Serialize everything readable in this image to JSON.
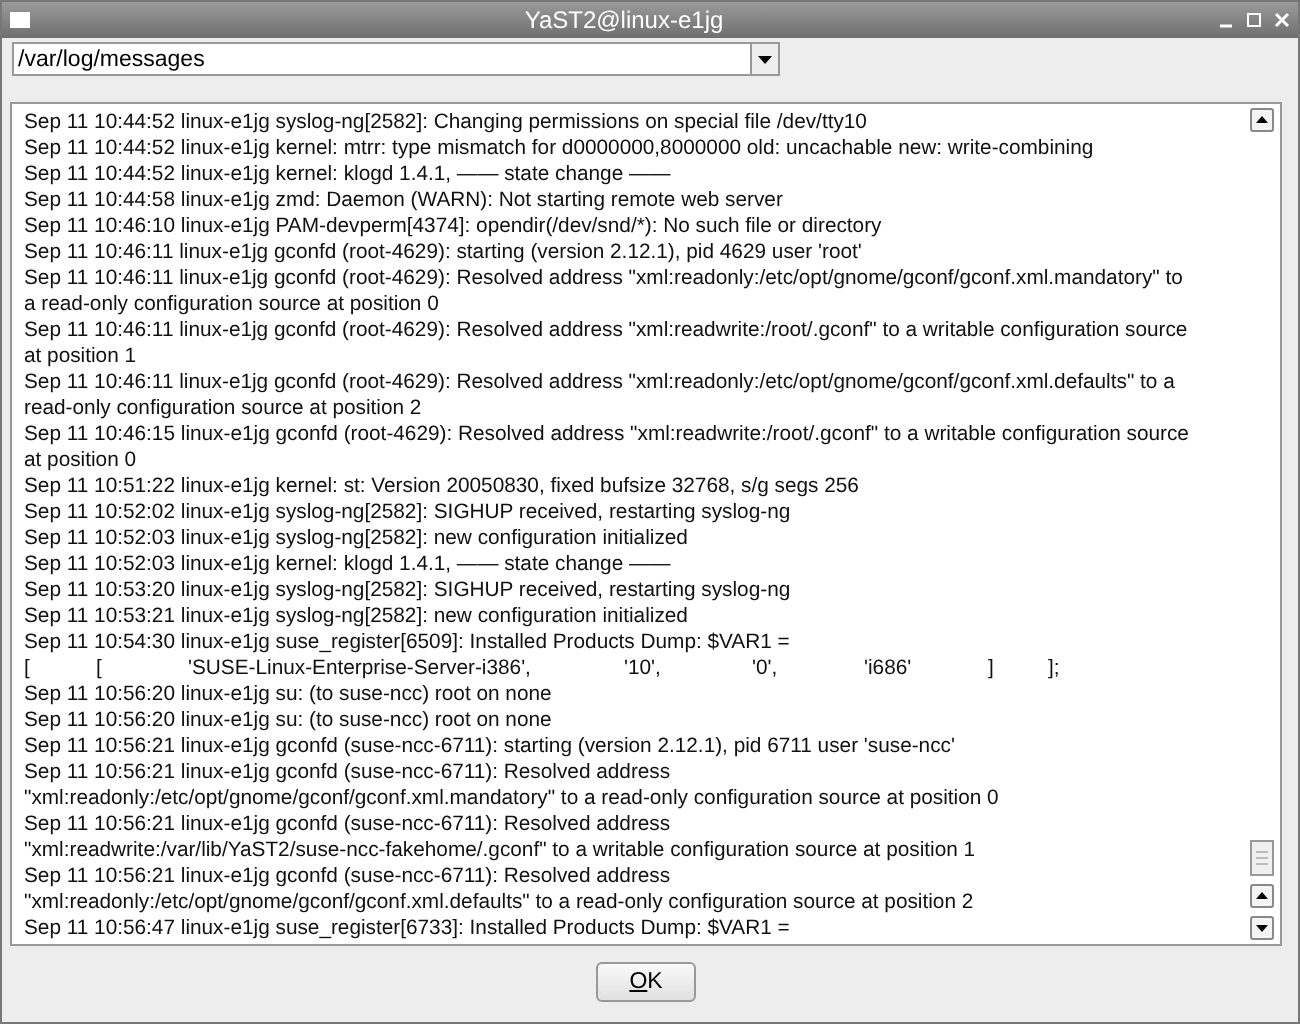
{
  "window": {
    "title": "YaST2@linux-e1jg"
  },
  "file_combo": {
    "value": "/var/log/messages"
  },
  "log_lines": [
    {
      "kind": "text",
      "text": "Sep 11 10:44:52 linux-e1jg syslog-ng[2582]: Changing permissions on special file /dev/tty10"
    },
    {
      "kind": "text",
      "text": "Sep 11 10:44:52 linux-e1jg kernel: mtrr: type mismatch for d0000000,8000000 old: uncachable new: write-combining"
    },
    {
      "kind": "text",
      "text": "Sep 11 10:44:52 linux-e1jg kernel: klogd 1.4.1, —— state change ——"
    },
    {
      "kind": "text",
      "text": "Sep 11 10:44:58 linux-e1jg zmd: Daemon (WARN): Not starting remote web server"
    },
    {
      "kind": "text",
      "text": "Sep 11 10:46:10 linux-e1jg PAM-devperm[4374]: opendir(/dev/snd/*): No such file or directory"
    },
    {
      "kind": "text",
      "text": "Sep 11 10:46:11 linux-e1jg gconfd (root-4629): starting (version 2.12.1), pid 4629 user 'root'"
    },
    {
      "kind": "text",
      "text": "Sep 11 10:46:11 linux-e1jg gconfd (root-4629): Resolved address \"xml:readonly:/etc/opt/gnome/gconf/gconf.xml.mandatory\" to"
    },
    {
      "kind": "text",
      "text": "a read-only configuration source at position 0"
    },
    {
      "kind": "text",
      "text": "Sep 11 10:46:11 linux-e1jg gconfd (root-4629): Resolved address \"xml:readwrite:/root/.gconf\" to a writable configuration source"
    },
    {
      "kind": "text",
      "text": "at position 1"
    },
    {
      "kind": "text",
      "text": "Sep 11 10:46:11 linux-e1jg gconfd (root-4629): Resolved address \"xml:readonly:/etc/opt/gnome/gconf/gconf.xml.defaults\" to a"
    },
    {
      "kind": "text",
      "text": "read-only configuration source at position 2"
    },
    {
      "kind": "text",
      "text": "Sep 11 10:46:15 linux-e1jg gconfd (root-4629): Resolved address \"xml:readwrite:/root/.gconf\" to a writable configuration source"
    },
    {
      "kind": "text",
      "text": "at position 0"
    },
    {
      "kind": "text",
      "text": "Sep 11 10:51:22 linux-e1jg kernel: st: Version 20050830, fixed bufsize 32768, s/g segs 256"
    },
    {
      "kind": "text",
      "text": "Sep 11 10:52:02 linux-e1jg syslog-ng[2582]: SIGHUP received, restarting syslog-ng"
    },
    {
      "kind": "text",
      "text": "Sep 11 10:52:03 linux-e1jg syslog-ng[2582]: new configuration initialized"
    },
    {
      "kind": "text",
      "text": "Sep 11 10:52:03 linux-e1jg kernel: klogd 1.4.1, —— state change ——"
    },
    {
      "kind": "text",
      "text": "Sep 11 10:53:20 linux-e1jg syslog-ng[2582]: SIGHUP received, restarting syslog-ng"
    },
    {
      "kind": "text",
      "text": "Sep 11 10:53:21 linux-e1jg syslog-ng[2582]: new configuration initialized"
    },
    {
      "kind": "text",
      "text": "Sep 11 10:54:30 linux-e1jg suse_register[6509]: Installed Products Dump: $VAR1 ="
    },
    {
      "kind": "columns",
      "cells": [
        "[",
        "[",
        "'SUSE-Linux-Enterprise-Server-i386',",
        "'10',",
        "'0',",
        "'i686'",
        "]",
        "];"
      ]
    },
    {
      "kind": "text",
      "text": "Sep 11 10:56:20 linux-e1jg su: (to suse-ncc) root on none"
    },
    {
      "kind": "text",
      "text": "Sep 11 10:56:20 linux-e1jg su: (to suse-ncc) root on none"
    },
    {
      "kind": "text",
      "text": "Sep 11 10:56:21 linux-e1jg gconfd (suse-ncc-6711): starting (version 2.12.1), pid 6711 user 'suse-ncc'"
    },
    {
      "kind": "text",
      "text": "Sep 11 10:56:21 linux-e1jg gconfd (suse-ncc-6711): Resolved address"
    },
    {
      "kind": "text",
      "text": "\"xml:readonly:/etc/opt/gnome/gconf/gconf.xml.mandatory\" to a read-only configuration source at position 0"
    },
    {
      "kind": "text",
      "text": "Sep 11 10:56:21 linux-e1jg gconfd (suse-ncc-6711): Resolved address"
    },
    {
      "kind": "text",
      "text": "\"xml:readwrite:/var/lib/YaST2/suse-ncc-fakehome/.gconf\" to a writable configuration source at position 1"
    },
    {
      "kind": "text",
      "text": "Sep 11 10:56:21 linux-e1jg gconfd (suse-ncc-6711): Resolved address"
    },
    {
      "kind": "text",
      "text": "\"xml:readonly:/etc/opt/gnome/gconf/gconf.xml.defaults\" to a read-only configuration source at position 2"
    },
    {
      "kind": "text",
      "text": "Sep 11 10:56:47 linux-e1jg suse_register[6733]: Installed Products Dump: $VAR1 ="
    }
  ],
  "ok_button": {
    "label": "OK"
  }
}
